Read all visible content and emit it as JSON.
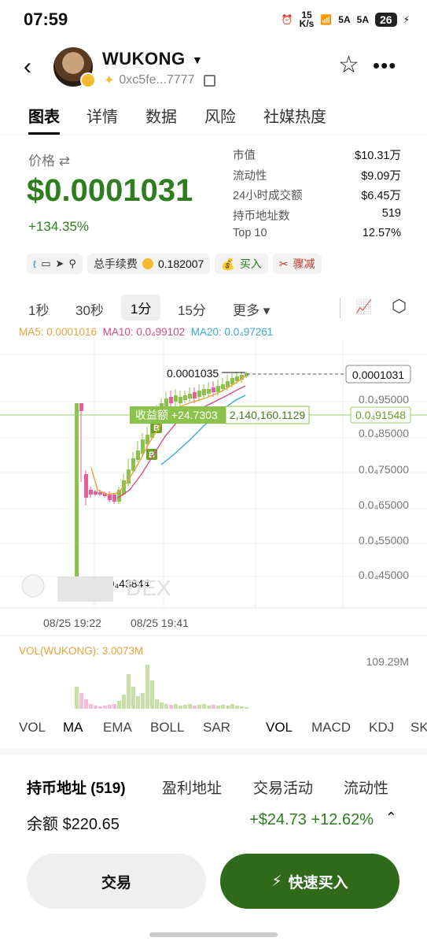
{
  "status_bar": {
    "time": "07:59",
    "net_speed_top": "15",
    "net_speed_unit": "K/s",
    "signal1": "5A",
    "signal2": "5A",
    "battery": "26"
  },
  "header": {
    "token_name": "WUKONG",
    "address": "0xc5fe...7777"
  },
  "tabs": [
    "图表",
    "详情",
    "数据",
    "风险",
    "社媒热度"
  ],
  "price": {
    "label": "价格",
    "value": "$0.0001031",
    "change": "+134.35%"
  },
  "stats": [
    {
      "k": "市值",
      "v": "$10.31万"
    },
    {
      "k": "流动性",
      "v": "$9.09万"
    },
    {
      "k": "24小时成交额",
      "v": "$6.45万"
    },
    {
      "k": "持币地址数",
      "v": "519"
    },
    {
      "k": "Top 10",
      "v": "12.57%"
    }
  ],
  "chips": {
    "fee_label": "总手续费",
    "fee_value": "0.182007",
    "buy": "买入",
    "sell": "骤减"
  },
  "timeframes": [
    "1秒",
    "30秒",
    "1分",
    "15分",
    "更多"
  ],
  "ma": {
    "ma5": "MA5: 0.0001016",
    "ma10": "MA10: 0.0₄99102",
    "ma20": "MA20: 0.0₄97261"
  },
  "chart_data": {
    "type": "candlestick",
    "y_ticks": [
      "0.0001031",
      "0.0₄95000",
      "0.0₄91548",
      "0.0₄85000",
      "0.0₄75000",
      "0.0₄65000",
      "0.0₄55000",
      "0.0₄45000"
    ],
    "x_ticks": [
      "08/25 19:22",
      "08/25 19:41"
    ],
    "high_label": "0.0001035",
    "low_label": "0.0₄43844",
    "pnl_label": "收益额 +24.7303",
    "pnl_amount": "2,140,160.1129",
    "buy_markers": [
      "B",
      "B"
    ],
    "watermark": "DEX",
    "vol_label": "VOL(WUKONG): 3.0073M",
    "vol_max": "109.29M",
    "colors": {
      "up": "#8bc34a",
      "down": "#ec5b9a",
      "ma5": "#e8a33c",
      "ma10": "#d44b8a",
      "ma20": "#3aa9d9"
    }
  },
  "indicator_tabs": [
    "VOL",
    "MA",
    "EMA",
    "BOLL",
    "SAR",
    "VOL",
    "MACD",
    "KDJ",
    "SK"
  ],
  "holder_tabs": [
    "持币地址 (519)",
    "盈利地址",
    "交易活动",
    "流动性"
  ],
  "balance": {
    "label": "余额",
    "value": "$220.65",
    "pnl": "+$24.73 +12.62%"
  },
  "buttons": {
    "trade": "交易",
    "quick_buy": "快速买入"
  }
}
